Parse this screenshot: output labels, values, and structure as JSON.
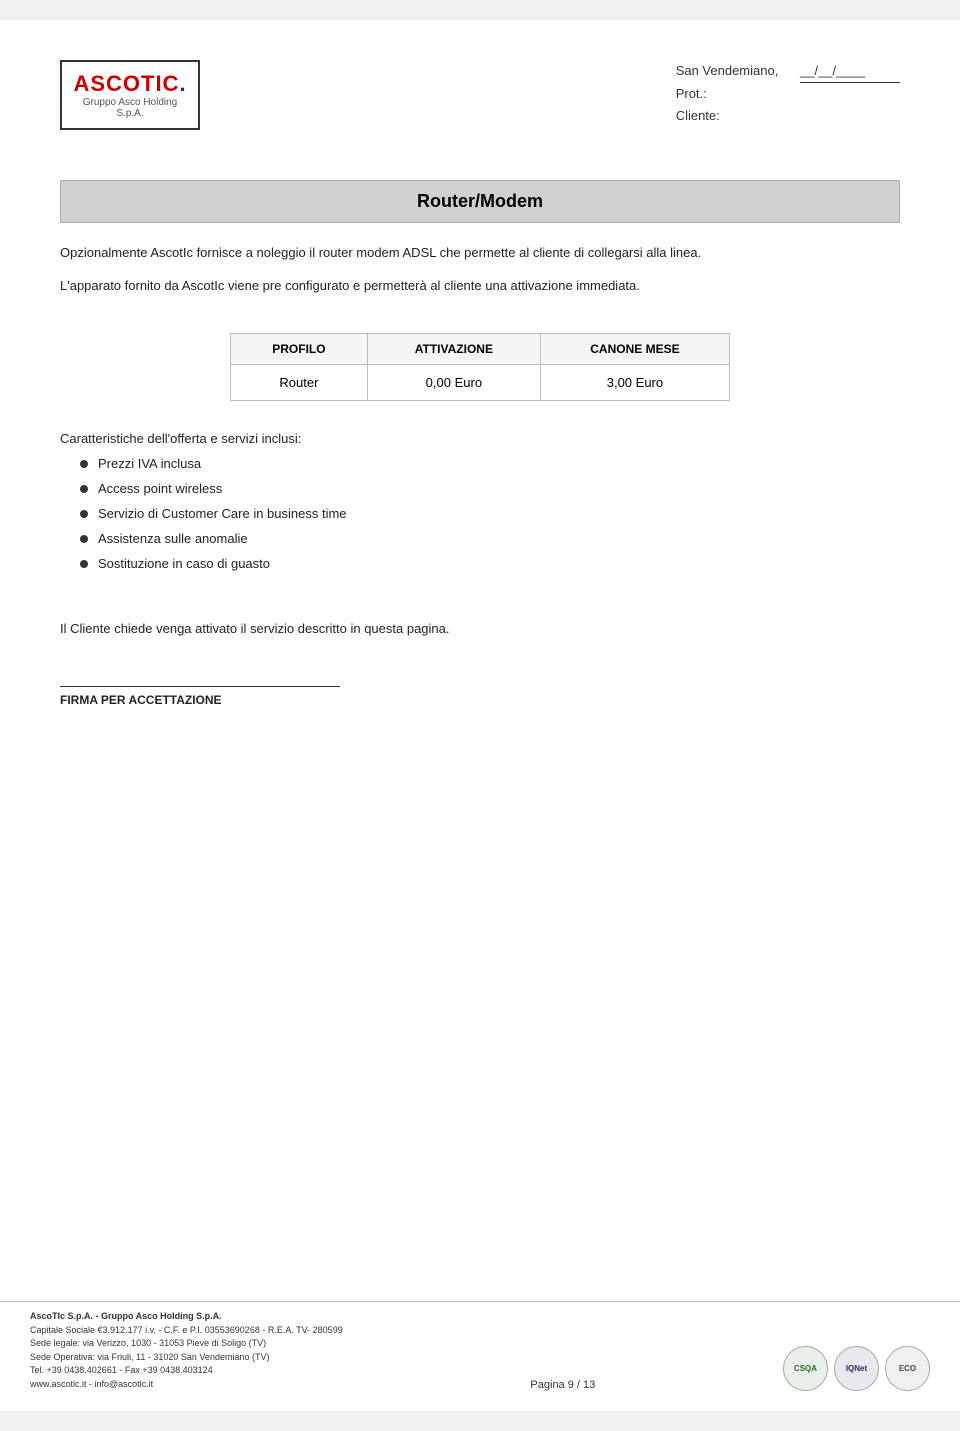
{
  "header": {
    "location": "San Vendemiano,",
    "date_label": "__/__/____",
    "prot_label": "Prot.:",
    "cliente_label": "Cliente:"
  },
  "logo": {
    "text_red": "ASCOTIC",
    "text_dot": ".",
    "sub_text": "Gruppo Asco Holding S.p.A."
  },
  "title": "Router/Modem",
  "intro_text1": "Opzionalmente AscotIc fornisce a noleggio il router modem ADSL che permette al cliente di collegarsi alla linea.",
  "intro_text2": "L'apparato fornito da AscotIc viene pre configurato e permetterà al cliente una attivazione immediata.",
  "table": {
    "headers": [
      "PROFILO",
      "ATTIVAZIONE",
      "CANONE MESE"
    ],
    "rows": [
      [
        "Router",
        "0,00 Euro",
        "3,00 Euro"
      ]
    ]
  },
  "features_title": "Caratteristiche dell'offerta e servizi inclusi:",
  "features": [
    "Prezzi IVA inclusa",
    "Access point wireless",
    "Servizio di Customer Care in business time",
    "Assistenza sulle anomalie",
    "Sostituzione in caso di guasto"
  ],
  "client_request_text": "Il Cliente chiede venga attivato il servizio descritto in questa pagina.",
  "signature_label": "FIRMA PER ACCETTAZIONE",
  "footer": {
    "company_line1": "AscoTIc S.p.A. - Gruppo Asco Holding S.p.A.",
    "company_line2": "Capitale Sociale €3.912.177 i.v. - C.F. e P.I. 03553690268 - R.E.A. TV- 280599",
    "company_line3": "Sede legale:  via Verizzo, 1030 -  31053 Pieve di Soligo (TV)",
    "company_line4": "Sede Operativa:  via Friuli, 11 - 31020 San Vendemiano (TV)",
    "company_line5": "Tel. +39 0438.402661 - Fax +39 0438.403124",
    "company_line6": "www.ascotlc.it  -  info@ascotlc.it",
    "page_label": "Pagina 9 / 13",
    "cert1": "CSQA",
    "cert2": "IQNet",
    "cert3": "ECO"
  }
}
